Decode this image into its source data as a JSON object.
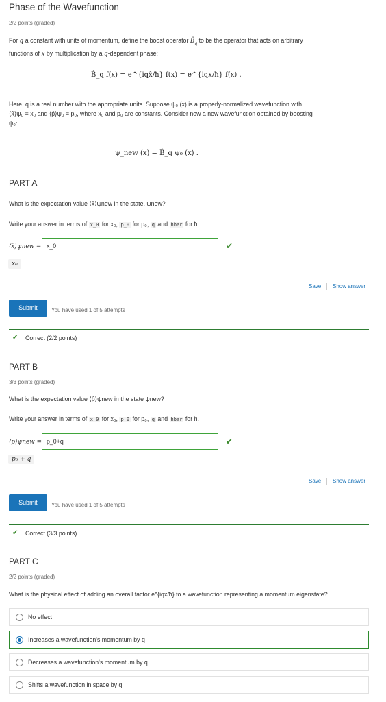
{
  "header": {
    "title": "Phase of the Wavefunction",
    "points": "2/2 points (graded)"
  },
  "intro": {
    "line1_a": "For",
    "line1_b": "a constant with units of momentum, define the boost operator",
    "line1_c": "to be the operator that acts on arbitrary",
    "line2_a": "functions of",
    "line2_b": "by multiplication by a",
    "line2_c": "-dependent phase:",
    "equation1": "B̂_q f(x) = e^{iqx̂/ħ} f(x) = e^{iqx/ħ} f(x) .",
    "para2_line1": "Here, q is a real number with the appropriate units. Suppose ψ₀ (x) is a properly-normalized wavefunction with",
    "para2_line2": "⟨x̂⟩ψ₀ = x₀ and ⟨p̂⟩ψ₀ = p₀, where x₀ and p₀ are constants. Consider now a new wavefunction obtained by boosting",
    "para2_line3": "ψ₀:",
    "equation2": "ψ_new (x) = B̂_q ψ₀ (x) ."
  },
  "partA": {
    "title": "PART A",
    "question": "What is the expectation value ⟨x̂⟩ψnew in the state, ψnew?",
    "instruction_prefix": "Write your answer in terms of",
    "codes": [
      "x_0",
      "p_0",
      "q",
      "hbar"
    ],
    "instruction_for": [
      "for x₀,",
      "for p₀,",
      "and",
      "for ħ."
    ],
    "answer_label": "⟨x̂⟩ψnew =",
    "input_value": "x_0",
    "preview": "x₀",
    "save": "Save",
    "show_answer": "Show answer",
    "submit": "Submit",
    "attempts": "You have used 1 of 5 attempts",
    "status": "Correct (2/2 points)"
  },
  "partB": {
    "title": "PART B",
    "points": "3/3 points (graded)",
    "question": "What is the expectation value ⟨p̂⟩ψnew in the state ψnew?",
    "instruction_prefix": "Write your answer in terms of",
    "codes": [
      "x_0",
      "p_0",
      "q",
      "hbar"
    ],
    "instruction_for": [
      "for x₀,",
      "for p₀,",
      "and",
      "for ħ."
    ],
    "answer_label": "⟨p⟩ψnew =",
    "input_value": "p_0+q",
    "preview": "p₀ + q",
    "save": "Save",
    "show_answer": "Show answer",
    "submit": "Submit",
    "attempts": "You have used 1 of 5 attempts",
    "status": "Correct (3/3 points)"
  },
  "partC": {
    "title": "PART C",
    "points": "2/2 points (graded)",
    "question": "What is the physical effect of adding an overall factor e^{iqx/ħ} to a wavefunction representing a momentum eigenstate?",
    "options": [
      {
        "label": "No effect",
        "selected": false
      },
      {
        "label": "Increases a wavefunction's momentum by q",
        "selected": true
      },
      {
        "label": "Decreases a wavefunction's momentum by q",
        "selected": false
      },
      {
        "label": "Shifts a wavefunction in space by q",
        "selected": false
      }
    ]
  },
  "colors": {
    "accent": "#1a74b9",
    "correct": "#2e7d32",
    "text": "#313131"
  }
}
